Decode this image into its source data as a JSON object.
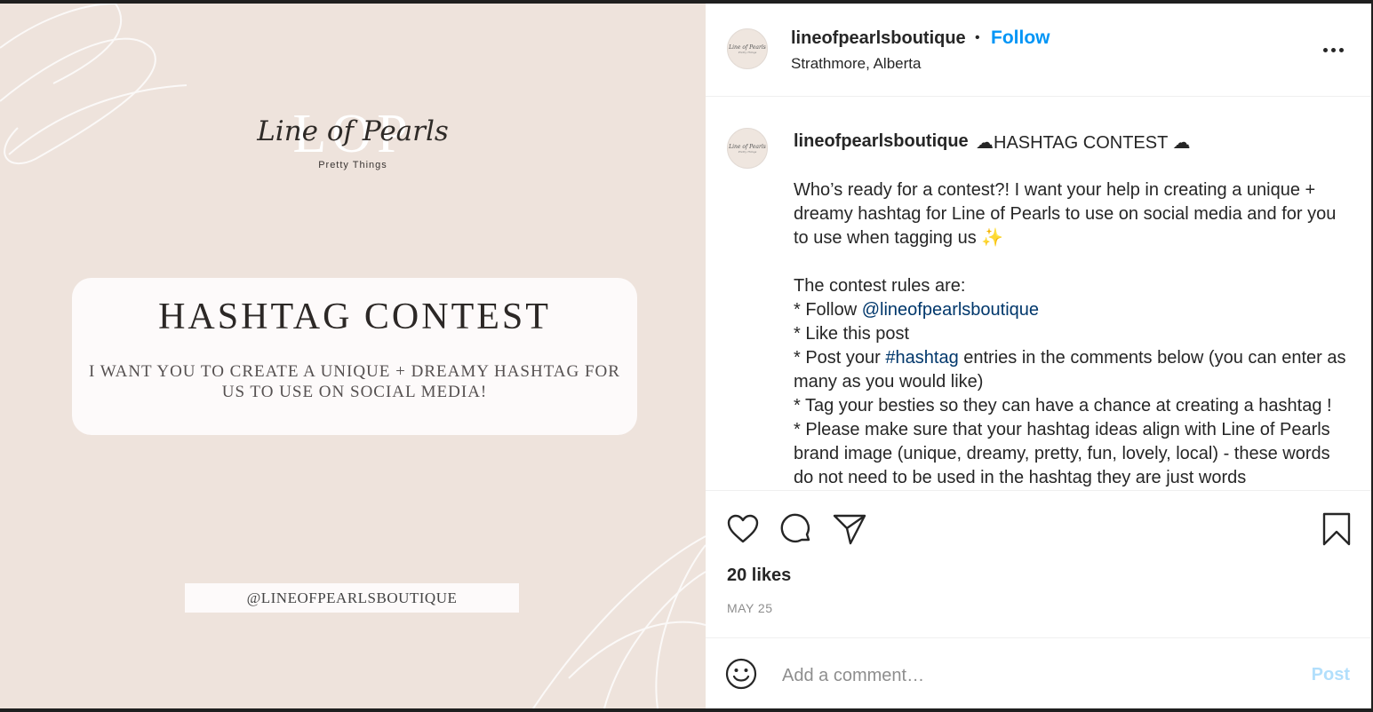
{
  "post_image": {
    "brand_monogram": "LOP",
    "brand_name": "Line of Pearls",
    "brand_tagline": "Pretty Things",
    "contest_title": "HASHTAG CONTEST",
    "contest_body": "I WANT YOU TO CREATE A UNIQUE + DREAMY HASHTAG FOR US TO USE ON SOCIAL MEDIA!",
    "handle": "@LINEOFPEARLSBOUTIQUE",
    "background_color": "#eee3dc"
  },
  "header": {
    "username": "lineofpearlsboutique",
    "separator": "•",
    "follow_label": "Follow",
    "location": "Strathmore, Alberta",
    "avatar_text": "Line of Pearls",
    "avatar_subtext": "Pretty Things"
  },
  "caption": {
    "username": "lineofpearlsboutique",
    "title": "☁HASHTAG CONTEST ☁",
    "intro": "Who’s ready for a contest?! I want your help in creating a unique + dreamy hashtag for Line of Pearls to use on social media and for you to use when tagging us",
    "intro_emoji": "✨",
    "rules_heading": "The contest rules are:",
    "rule1_prefix": "* Follow ",
    "rule1_mention": "@lineofpearlsboutique",
    "rule2": "* Like this post",
    "rule3_prefix": "* Post your ",
    "rule3_hashtag": "#hashtag",
    "rule3_suffix": " entries in the comments below (you can enter as many as you would like)",
    "rule4": "* Tag your besties so they can have a chance at creating a hashtag !",
    "rule5": "* Please make sure that your hashtag ideas align with Line of Pearls brand image (unique, dreamy, pretty, fun, lovely, local) - these words do not need to be used in the hashtag they are just words"
  },
  "actions": {
    "like_icon": "heart-icon",
    "comment_icon": "comment-bubble-icon",
    "share_icon": "paper-plane-icon",
    "save_icon": "bookmark-icon",
    "likes": "20 likes",
    "date": "MAY 25"
  },
  "comment_bar": {
    "emoji_icon": "smiley-icon",
    "placeholder": "Add a comment…",
    "post_label": "Post",
    "post_color": "#b2dffc"
  },
  "colors": {
    "follow": "#0095f6",
    "link": "#00376b"
  }
}
